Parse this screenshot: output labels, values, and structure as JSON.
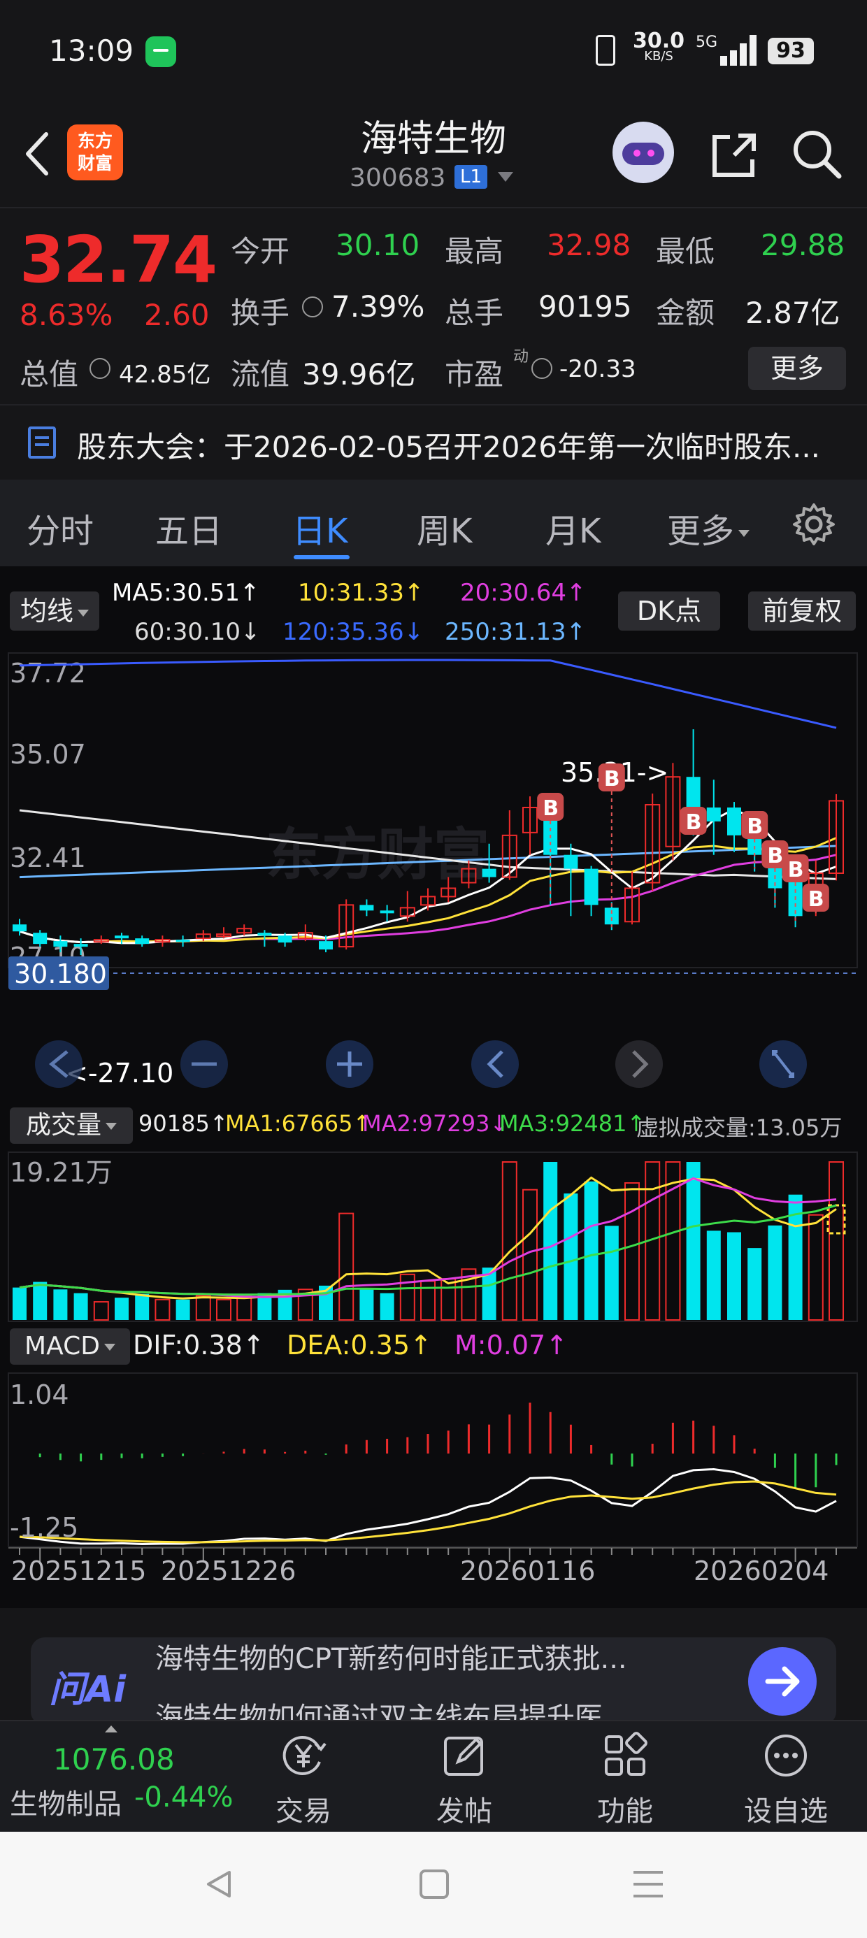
{
  "status_bar": {
    "time": "13:09",
    "net_speed": "30.0",
    "net_unit": "KB/S",
    "signal": "5G",
    "battery": "93"
  },
  "header": {
    "logo_text_1": "东方",
    "logo_text_2": "财富",
    "stock_name": "海特生物",
    "stock_code": "300683",
    "level_badge": "L1"
  },
  "quote": {
    "price": "32.74",
    "change_pct": "8.63%",
    "change": "2.60",
    "open_label": "今开",
    "open": "30.10",
    "high_label": "最高",
    "high": "32.98",
    "low_label": "最低",
    "low": "29.88",
    "turnover_label": "换手",
    "turnover": "7.39%",
    "volume_label": "总手",
    "volume": "90195",
    "amount_label": "金额",
    "amount": "2.87亿",
    "total_cap_label": "总值",
    "total_cap": "42.85亿",
    "float_cap_label": "流值",
    "float_cap": "39.96亿",
    "pe_label": "市盈",
    "pe_sup": "动",
    "pe": "-20.33",
    "more_label": "更多"
  },
  "notice": {
    "text": "股东大会：于2026-02-05召开2026年第一次临时股东..."
  },
  "tabs": [
    "分时",
    "五日",
    "日K",
    "周K",
    "月K",
    "更多"
  ],
  "active_tab": "日K",
  "kline_panel": {
    "ma_selector": "均线",
    "ma5": "MA5:30.51↑",
    "ma10": "10:31.33↑",
    "ma20": "20:30.64↑",
    "ma60": "60:30.10↓",
    "ma120": "120:35.36↓",
    "ma250": "250:31.13↑",
    "dk_button": "DK点",
    "adjust_button": "前复权",
    "y_top": "37.72",
    "y_2": "35.07",
    "y_3": "32.41",
    "y_bottom": "27.10",
    "current_price_tag": "30.180",
    "high_marker": "35.31->",
    "low_marker": "<-27.10",
    "watermark": "东方财富",
    "buy_marker": "B"
  },
  "volume_panel": {
    "selector": "成交量",
    "vol": "90185↑",
    "ma1": "MA1:67665↑",
    "ma2": "MA2:97293↓",
    "ma3": "MA3:92481↑",
    "virtual": "虚拟成交量:13.05万",
    "y_top": "19.21万"
  },
  "macd_panel": {
    "selector": "MACD",
    "dif": "DIF:0.38↑",
    "dea": "DEA:0.35↑",
    "m": "M:0.07↑",
    "y_top": "1.04",
    "y_bottom": "-1.25"
  },
  "x_dates": [
    "20251215",
    "20251226",
    "20260116",
    "20260204"
  ],
  "ai_bar": {
    "logo": "问Ai",
    "q1": "海特生物的CPT新药何时能正式获批...",
    "q2": "海特生物如何通过双主线布局提升医..."
  },
  "bottom_nav": {
    "index_value": "1076.08",
    "index_name": "生物制品",
    "index_change": "-0.44%",
    "trade": "交易",
    "post": "发帖",
    "function": "功能",
    "watchlist": "设自选"
  },
  "colors": {
    "up": "#ee2b2b",
    "down": "#00e5ee",
    "ma5": "#ffffff",
    "ma10": "#ffe23a",
    "ma20": "#e03ee0",
    "ma60": "#3ddc4a",
    "ma120": "#3a5bff",
    "ma250": "#6cb7ff",
    "accent": "#3f8cff"
  },
  "chart_data": {
    "type": "candlestick",
    "candles": [
      {
        "o": 28.3,
        "c": 28.05,
        "h": 28.5,
        "l": 27.9
      },
      {
        "o": 28.0,
        "c": 27.6,
        "h": 28.1,
        "l": 27.5
      },
      {
        "o": 27.7,
        "c": 27.5,
        "h": 27.9,
        "l": 27.3
      },
      {
        "o": 27.6,
        "c": 27.5,
        "h": 27.8,
        "l": 27.2
      },
      {
        "o": 27.7,
        "c": 27.75,
        "h": 27.9,
        "l": 27.6
      },
      {
        "o": 27.9,
        "c": 27.8,
        "h": 28.0,
        "l": 27.6
      },
      {
        "o": 27.8,
        "c": 27.6,
        "h": 27.9,
        "l": 27.5
      },
      {
        "o": 27.7,
        "c": 27.75,
        "h": 27.9,
        "l": 27.5
      },
      {
        "o": 27.75,
        "c": 27.7,
        "h": 27.9,
        "l": 27.5
      },
      {
        "o": 27.8,
        "c": 27.95,
        "h": 28.1,
        "l": 27.7
      },
      {
        "o": 27.9,
        "c": 27.95,
        "h": 28.2,
        "l": 27.8
      },
      {
        "o": 28.0,
        "c": 28.15,
        "h": 28.3,
        "l": 27.9
      },
      {
        "o": 28.0,
        "c": 27.9,
        "h": 28.1,
        "l": 27.5
      },
      {
        "o": 27.9,
        "c": 27.65,
        "h": 28.0,
        "l": 27.5
      },
      {
        "o": 27.8,
        "c": 28.0,
        "h": 28.3,
        "l": 27.7
      },
      {
        "o": 27.7,
        "c": 27.4,
        "h": 27.9,
        "l": 27.3
      },
      {
        "o": 27.5,
        "c": 29.0,
        "h": 29.2,
        "l": 27.4
      },
      {
        "o": 29.0,
        "c": 28.8,
        "h": 29.2,
        "l": 28.6
      },
      {
        "o": 28.8,
        "c": 28.7,
        "h": 29.0,
        "l": 28.4
      },
      {
        "o": 28.6,
        "c": 28.9,
        "h": 29.5,
        "l": 28.4
      },
      {
        "o": 29.0,
        "c": 29.3,
        "h": 29.6,
        "l": 28.8
      },
      {
        "o": 29.3,
        "c": 29.6,
        "h": 30.0,
        "l": 29.1
      },
      {
        "o": 29.8,
        "c": 30.3,
        "h": 30.6,
        "l": 29.6
      },
      {
        "o": 30.3,
        "c": 30.0,
        "h": 31.2,
        "l": 29.8
      },
      {
        "o": 30.0,
        "c": 31.5,
        "h": 32.4,
        "l": 29.9
      },
      {
        "o": 31.6,
        "c": 32.5,
        "h": 32.9,
        "l": 30.8
      },
      {
        "o": 32.4,
        "c": 30.8,
        "h": 32.6,
        "l": 29.0
      },
      {
        "o": 30.8,
        "c": 30.3,
        "h": 31.2,
        "l": 28.6
      },
      {
        "o": 30.3,
        "c": 29.0,
        "h": 30.4,
        "l": 28.6
      },
      {
        "o": 28.9,
        "c": 28.3,
        "h": 29.1,
        "l": 28.1
      },
      {
        "o": 28.4,
        "c": 29.6,
        "h": 30.2,
        "l": 28.3
      },
      {
        "o": 29.8,
        "c": 32.6,
        "h": 33.0,
        "l": 29.5
      },
      {
        "o": 31.1,
        "c": 33.6,
        "h": 34.1,
        "l": 30.6
      },
      {
        "o": 33.6,
        "c": 32.5,
        "h": 35.31,
        "l": 31.5
      },
      {
        "o": 32.5,
        "c": 32.0,
        "h": 33.5,
        "l": 30.8
      },
      {
        "o": 32.5,
        "c": 31.5,
        "h": 32.7,
        "l": 30.9
      },
      {
        "o": 31.5,
        "c": 30.8,
        "h": 31.8,
        "l": 30.2
      },
      {
        "o": 30.6,
        "c": 29.6,
        "h": 31.0,
        "l": 28.9
      },
      {
        "o": 30.3,
        "c": 28.6,
        "h": 30.5,
        "l": 28.2
      },
      {
        "o": 28.8,
        "c": 30.14,
        "h": 30.6,
        "l": 28.6
      },
      {
        "o": 30.14,
        "c": 32.74,
        "h": 32.98,
        "l": 29.88
      }
    ]
  }
}
